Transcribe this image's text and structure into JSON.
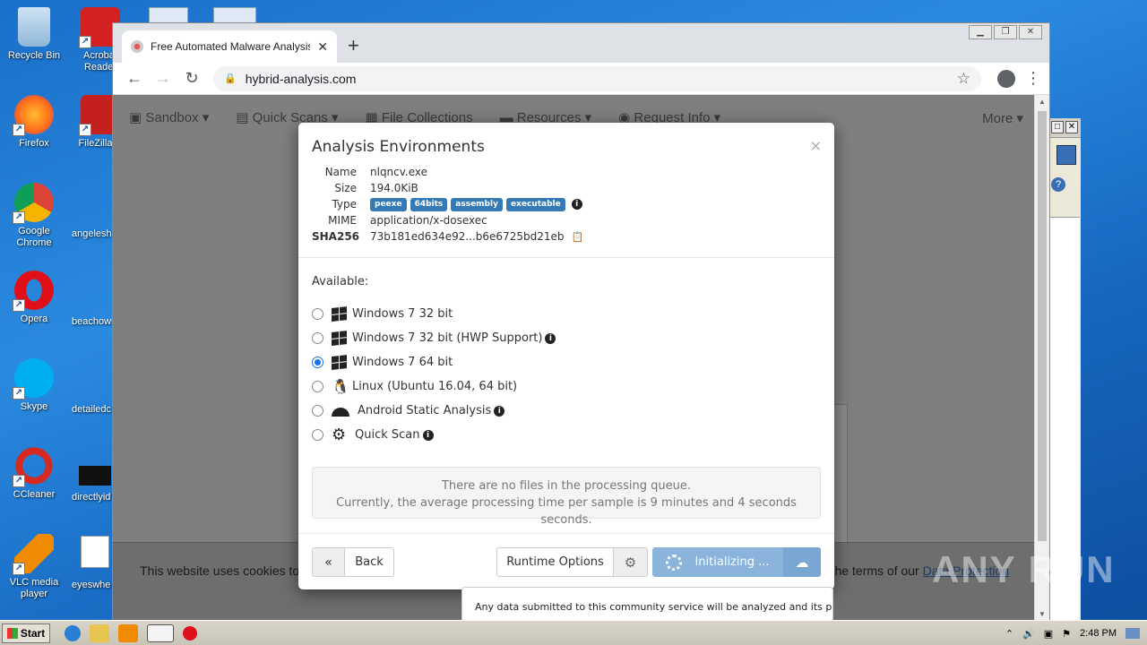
{
  "desktop": {
    "icons": [
      {
        "label": "Recycle Bin"
      },
      {
        "label": "Acrobat Reader"
      },
      {
        "label": "Firefox"
      },
      {
        "label": "FileZilla C"
      },
      {
        "label": "Google Chrome"
      },
      {
        "label": "Opera"
      },
      {
        "label": "Skype"
      },
      {
        "label": "CCleaner"
      },
      {
        "label": "VLC media player"
      }
    ],
    "partial_labels": [
      "angelesh",
      "beachowr",
      "detailedc",
      "directlyid",
      "eyeswhe"
    ]
  },
  "browser": {
    "tab_title": "Free Automated Malware Analysis S",
    "url": "hybrid-analysis.com",
    "site_nav": [
      "Sandbox",
      "Quick Scans",
      "File Collections",
      "Resources",
      "Request Info"
    ],
    "site_nav_more": "More",
    "cookie_left": "This website uses cookies to",
    "cookie_right": "o the terms of our",
    "cookie_link": "Data Protection"
  },
  "modal": {
    "title": "Analysis Environments",
    "close": "×",
    "file": {
      "name_label": "Name",
      "name": "nlqncv.exe",
      "size_label": "Size",
      "size": "194.0KiB",
      "type_label": "Type",
      "type_badges": [
        "peexe",
        "64bits",
        "assembly",
        "executable"
      ],
      "mime_label": "MIME",
      "mime": "application/x-dosexec",
      "sha_label": "SHA256",
      "sha256": "73b181ed634e92...b6e6725bd21eb"
    },
    "available_label": "Available:",
    "environments": [
      {
        "label": "Windows 7 32 bit",
        "selected": false
      },
      {
        "label": "Windows 7 32 bit (HWP Support)",
        "selected": false
      },
      {
        "label": "Windows 7 64 bit",
        "selected": true
      },
      {
        "label": "Linux (Ubuntu 16.04, 64 bit)",
        "selected": false
      },
      {
        "label": "Android Static Analysis",
        "selected": false
      },
      {
        "label": "Quick Scan",
        "selected": false
      }
    ],
    "queue_line1": "There are no files in the processing queue.",
    "queue_line2": "Currently, the average processing time per sample is 9 minutes and 4 seconds seconds.",
    "back_label": "Back",
    "runtime_label": "Runtime Options",
    "init_label": "Initializing ..."
  },
  "tooltip": "Any data submitted to this community service will be analyzed and its partial or",
  "watermark": "ANY RUN",
  "taskbar": {
    "start": "Start",
    "time": "2:48 PM"
  }
}
